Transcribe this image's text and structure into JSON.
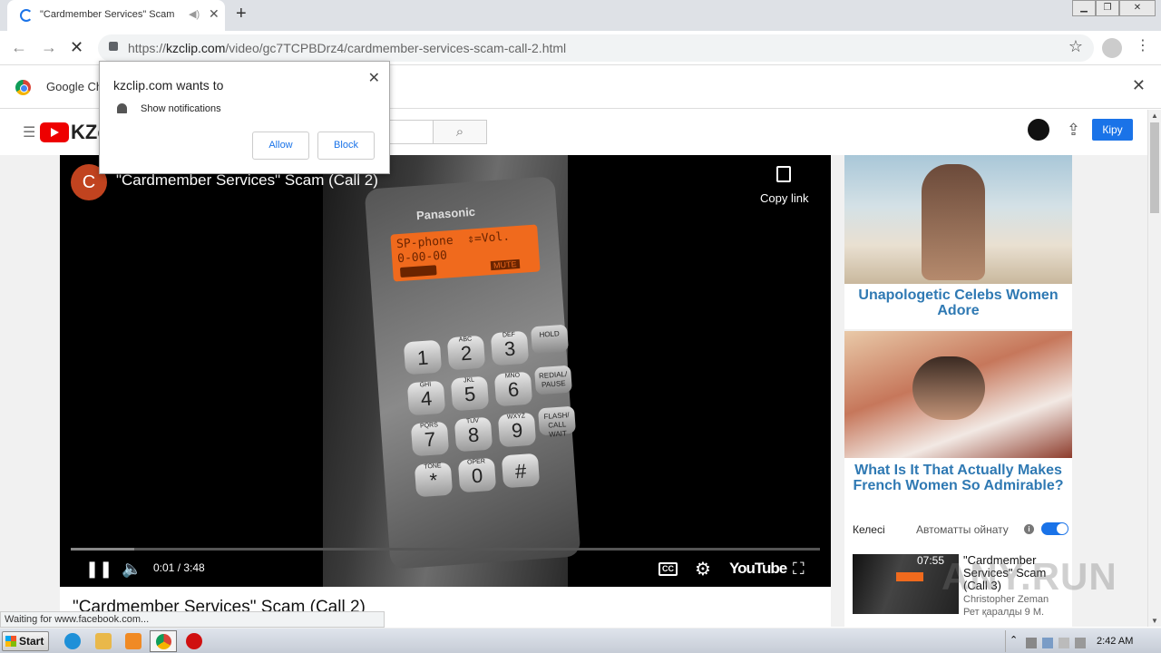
{
  "browser": {
    "tab_title": "\"Cardmember Services\" Scam (C",
    "url_prefix": "https://",
    "url_host": "kzclip.com",
    "url_path": "/video/gc7TCPBDrz4/cardmember-services-scam-call-2.html",
    "infobar_text": "Google Ch",
    "status_text": "Waiting for www.facebook.com..."
  },
  "site": {
    "logo_text": "KZc",
    "signin_label": "Кіру"
  },
  "video": {
    "channel_initial": "C",
    "title": "\"Cardmember Services\" Scam (Call 2)",
    "copy_link": "Copy link",
    "phone_brand": "Panasonic",
    "lcd_line1": "SP-phone  ⇕=Vol.",
    "lcd_line2": "0-00-00",
    "lcd_mute": "MUTE",
    "current_time": "0:01",
    "duration": "3:48",
    "time_display": "0:01 / 3:48",
    "progress_fraction": 0.085,
    "cc_label": "CC",
    "youtube_brand": "YouTube",
    "page_title": "\"Cardmember Services\" Scam (Call 2)",
    "keys": [
      {
        "digit": "1",
        "letters": ""
      },
      {
        "digit": "2",
        "letters": "ABC"
      },
      {
        "digit": "3",
        "letters": "DEF"
      },
      {
        "digit": "4",
        "letters": "GHI"
      },
      {
        "digit": "5",
        "letters": "JKL"
      },
      {
        "digit": "6",
        "letters": "MNO"
      },
      {
        "digit": "7",
        "letters": "PQRS"
      },
      {
        "digit": "8",
        "letters": "TUV"
      },
      {
        "digit": "9",
        "letters": "WXYZ"
      },
      {
        "digit": "*",
        "letters": "TONE"
      },
      {
        "digit": "0",
        "letters": "OPER"
      },
      {
        "digit": "#",
        "letters": ""
      }
    ],
    "fkeys": [
      "HOLD",
      "REDIAL/ PAUSE",
      "FLASH/ CALL WAIT"
    ]
  },
  "ads": [
    {
      "caption": "Unapologetic Celebs Women Adore"
    },
    {
      "caption": "What Is It That Actually Makes French Women So Admirable?"
    }
  ],
  "upnext": {
    "next_label": "Келесі",
    "autoplay_label": "Автоматты ойнату",
    "autoplay_on": true,
    "item": {
      "title": "\"Cardmember Services\" Scam (Call 3)",
      "duration": "07:55",
      "channel": "Christopher Zeman",
      "views": "Рет қаралды 9 М."
    },
    "watermark": "ANY.RUN"
  },
  "popup": {
    "title": "kzclip.com wants to",
    "message": "Show notifications",
    "allow": "Allow",
    "block": "Block"
  },
  "taskbar": {
    "start_label": "Start",
    "clock": "2:42 AM"
  },
  "colors": {
    "accent": "#1a73e8",
    "ad_caption": "#2f79b3",
    "lcd": "#f06a1d"
  }
}
